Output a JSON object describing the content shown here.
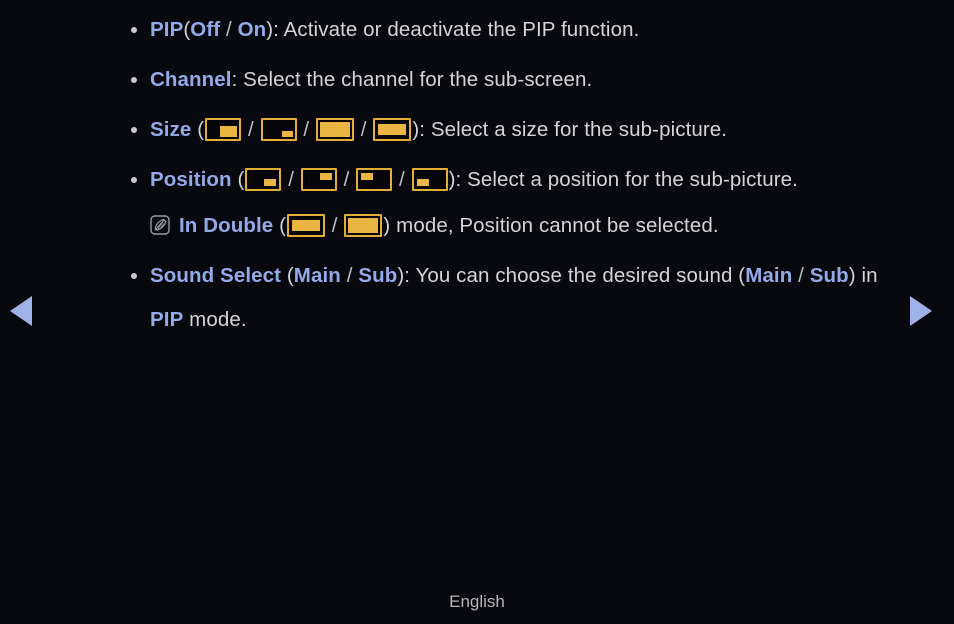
{
  "background_color": "#08080f",
  "colors": {
    "body_text": "#d4d4d8",
    "keyword": "#93aae8",
    "icon_gold": "#e8b339",
    "arrow": "#9fb2e8",
    "footer_text": "#b6b6ba"
  },
  "items": {
    "pip": {
      "term": "PIP",
      "open_paren": "(",
      "option_off": "Off",
      "slash": "/",
      "option_on": "On",
      "close_paren_colon": "): ",
      "description": "Activate or deactivate the PIP function."
    },
    "channel": {
      "term": "Channel",
      "colon": ": ",
      "description": "Select the channel for the sub-screen."
    },
    "size": {
      "term": "Size",
      "open_paren": " (",
      "slash": "/",
      "close_paren_colon": "): ",
      "description": "Select a size for the sub-picture.",
      "icons": [
        "pip-size-large-bottom-right-icon",
        "pip-size-small-bottom-right-icon",
        "pip-size-double-tall-icon",
        "pip-size-double-short-icon"
      ]
    },
    "position": {
      "term": "Position",
      "open_paren": " (",
      "slash": "/",
      "close_paren_colon": "): ",
      "description": "Select a position for the sub-picture.",
      "icons": [
        "pip-position-bottom-right-icon",
        "pip-position-top-right-icon",
        "pip-position-top-left-icon",
        "pip-position-bottom-left-icon"
      ]
    },
    "note": {
      "icon": "note-quill-icon",
      "term": "In Double",
      "open_paren": " (",
      "slash": "/",
      "close_paren": ") ",
      "text": "mode, Position cannot be selected.",
      "icons": [
        "pip-size-double-short-icon",
        "pip-size-double-tall-icon"
      ]
    },
    "sound_select": {
      "term": "Sound Select",
      "open_paren": " (",
      "option_main": "Main",
      "slash": "/",
      "option_sub": "Sub",
      "close_paren_colon": "): ",
      "desc_part1": "You can choose the desired sound (",
      "desc_main": "Main",
      "desc_slash": " / ",
      "desc_sub": "Sub",
      "desc_part2": ") in ",
      "desc_pip": "PIP",
      "desc_part3": " mode."
    }
  },
  "navigation": {
    "prev_label": "previous-page-arrow",
    "next_label": "next-page-arrow"
  },
  "footer": {
    "language": "English"
  }
}
